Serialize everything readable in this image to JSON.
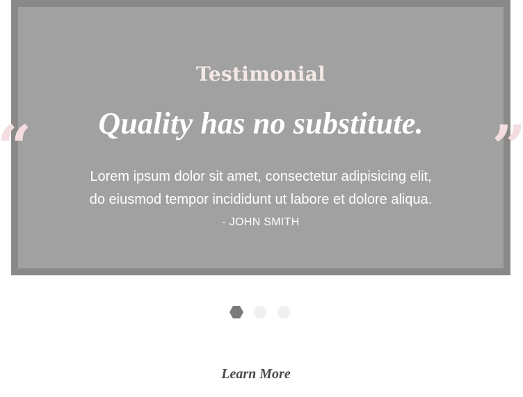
{
  "testimonial": {
    "eyebrow": "Testimonial",
    "headline": "Quality has no substitute.",
    "body_line_1": "Lorem ipsum dolor sit amet, consectetur adipisicing elit,",
    "body_line_2": "do eiusmod tempor incididunt ut labore et dolore aliqua.",
    "author": "- JOHN SMITH",
    "open_quote": "“",
    "close_quote": "”"
  },
  "carousel": {
    "slide_count": 3,
    "active_index": 0,
    "active_color": "#7a7a7a",
    "inactive_color": "#f0f0f0"
  },
  "cta": {
    "label": "Learn More"
  },
  "colors": {
    "frame": "#8b8987",
    "panel": "#a1a1a1",
    "quote_marks": "#f3dde0"
  }
}
